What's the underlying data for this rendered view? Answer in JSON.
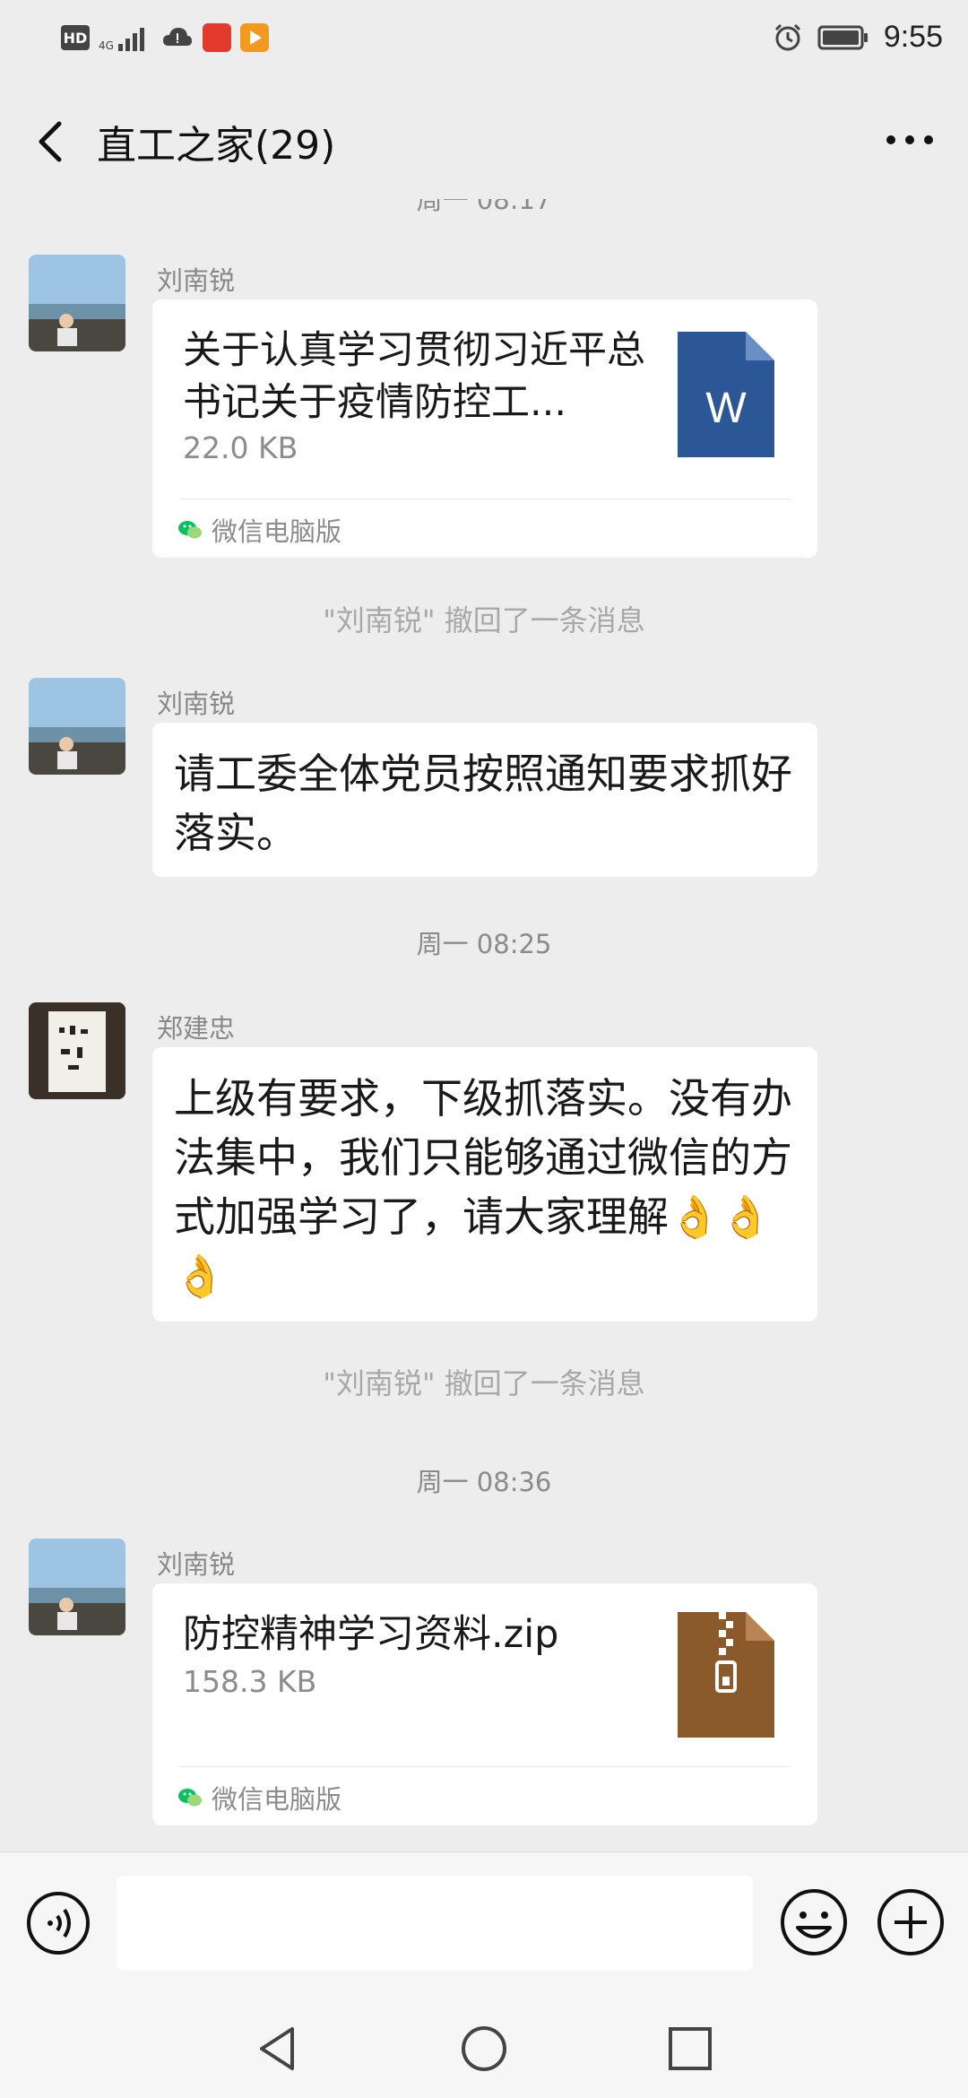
{
  "status_bar": {
    "hd": "HD",
    "network": "4G",
    "time": "9:55"
  },
  "header": {
    "title": "直工之家(29)"
  },
  "messages": {
    "top_cut_timestamp": "周一 08:17",
    "m1": {
      "sender": "刘南锐",
      "file_name": "关于认真学习贯彻习近平总书记关于疫情防控工...",
      "file_size": "22.0 KB",
      "file_source": "微信电脑版",
      "file_icon_letter": "W"
    },
    "sys1": "\"刘南锐\" 撤回了一条消息",
    "m2": {
      "sender": "刘南锐",
      "text": "请工委全体党员按照通知要求抓好落实。"
    },
    "ts1": "周一 08:25",
    "m3": {
      "sender": "郑建忠",
      "text": "上级有要求，下级抓落实。没有办法集中，我们只能够通过微信的方式加强学习了，请大家理解👌👌👌"
    },
    "sys2": "\"刘南锐\" 撤回了一条消息",
    "ts2": "周一 08:36",
    "m4": {
      "sender": "刘南锐",
      "file_name": "防控精神学习资料.zip",
      "file_size": "158.3 KB",
      "file_source": "微信电脑版"
    }
  },
  "colors": {
    "background": "#ededed",
    "word_blue": "#2b5797",
    "zip_brown": "#8b5a2b",
    "wechat_green": "#07c160"
  }
}
